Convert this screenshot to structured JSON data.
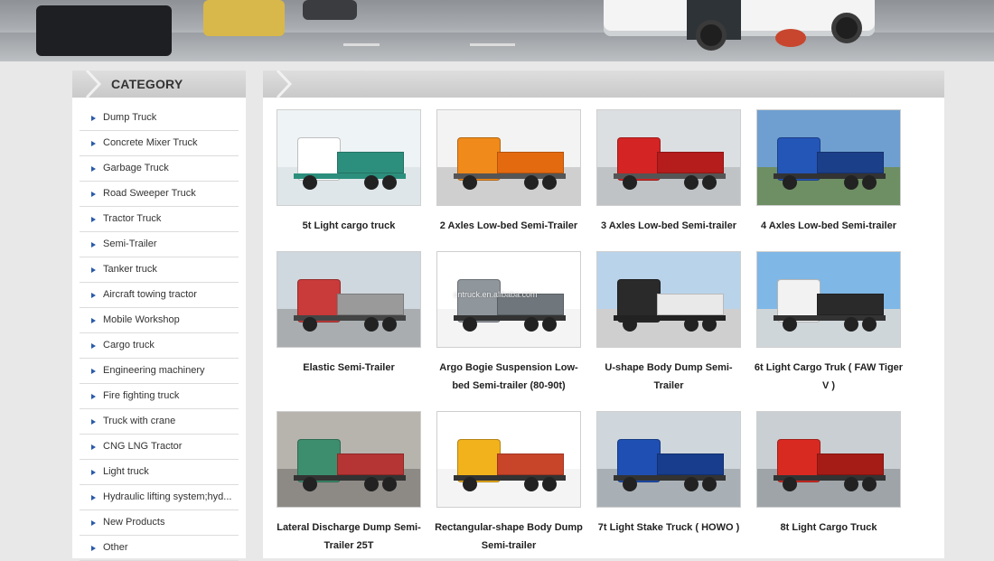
{
  "sidebar": {
    "title": "CATEGORY",
    "items": [
      {
        "label": "Dump Truck"
      },
      {
        "label": "Concrete Mixer Truck"
      },
      {
        "label": "Garbage Truck"
      },
      {
        "label": "Road Sweeper Truck"
      },
      {
        "label": "Tractor Truck"
      },
      {
        "label": "Semi-Trailer"
      },
      {
        "label": "Tanker truck"
      },
      {
        "label": "Aircraft towing tractor"
      },
      {
        "label": "Mobile Workshop"
      },
      {
        "label": "Cargo truck"
      },
      {
        "label": "Engineering machinery"
      },
      {
        "label": "Fire fighting truck"
      },
      {
        "label": "Truck with crane"
      },
      {
        "label": "CNG LNG Tractor"
      },
      {
        "label": "Light truck"
      },
      {
        "label": "Hydraulic lifting system;hyd..."
      },
      {
        "label": "New Products"
      },
      {
        "label": "Other"
      }
    ]
  },
  "products": [
    {
      "line1": "5t Light cargo truck",
      "line2": "",
      "scene": "white-truck"
    },
    {
      "line1": "2 Axles Low-bed Semi-Trailer",
      "line2": "",
      "scene": "orange-lowbed"
    },
    {
      "line1": "3 Axles Low-bed Semi-trailer",
      "line2": "",
      "scene": "red-lowbed"
    },
    {
      "line1": "4 Axles Low-bed Semi-trailer",
      "line2": "",
      "scene": "blue-lowbed"
    },
    {
      "line1": "Elastic Semi-Trailer",
      "line2": "",
      "scene": "red-flatbed"
    },
    {
      "line1": "Argo Bogie Suspension Low-",
      "line2": "bed Semi-trailer (80-90t)",
      "scene": "grey-ramp"
    },
    {
      "line1": "U-shape Body Dump Semi-",
      "line2": "Trailer",
      "scene": "black-dump"
    },
    {
      "line1": "6t Light Cargo Truk ( FAW Tiger",
      "line2": "V )",
      "scene": "white-cab"
    },
    {
      "line1": "Lateral Discharge Dump Semi-",
      "line2": "Trailer 25T",
      "scene": "green-side"
    },
    {
      "line1": "Rectangular-shape Body Dump",
      "line2": "Semi-trailer",
      "scene": "yellow-dump"
    },
    {
      "line1": "7t Light Stake Truck ( HOWO )",
      "line2": "",
      "scene": "blue-stake"
    },
    {
      "line1": "8t Light Cargo Truck",
      "line2": "",
      "scene": "red-cargo"
    }
  ],
  "thumbnail_texts": {
    "watermark": "cntruck.en.alibaba.com"
  },
  "colors": {
    "accent": "#2a5aa8",
    "header_bg": "#d4d4d4",
    "page_bg": "#e8e8e8"
  }
}
